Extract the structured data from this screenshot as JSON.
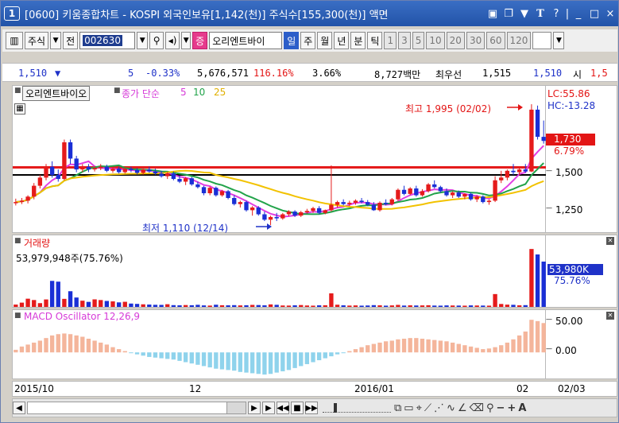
{
  "window": {
    "number": "1",
    "title": "[0600] 키움종합차트 - KOSPI 외국인보유[1,142(천)] 주식수[155,300(천)] 액면",
    "controls": [
      "□",
      "⊡",
      "▼",
      "T",
      "?",
      "_",
      "□",
      "×"
    ]
  },
  "toolbar": {
    "market_label": "주식",
    "prev_label": "전",
    "stock_code": "002630",
    "stock_name": "오리엔트바이",
    "increase_btn": "증",
    "periods": [
      "일",
      "주",
      "월",
      "년",
      "분",
      "틱"
    ],
    "active_period": "일",
    "intervals": [
      "1",
      "3",
      "5",
      "10",
      "20",
      "30",
      "60",
      "120"
    ]
  },
  "quote": {
    "price": "1,510",
    "change": "5",
    "change_pct": "-0.33%",
    "volume": "5,676,571",
    "volume_ratio": "116.16%",
    "turnover": "3.66%",
    "amount": "8,727백만",
    "best_label": "최우선",
    "best_ask": "1,515",
    "best_bid": "1,510",
    "open_label": "시",
    "open_value": "1,5"
  },
  "price_panel": {
    "stock_label": "오리엔트바이오",
    "ma_label": "종가 단순",
    "ma_periods": [
      "5",
      "10",
      "25"
    ],
    "ma_colors": [
      "#e23ee3",
      "#22a34a",
      "#f2c200"
    ],
    "high_annotation": "최고 1,995 (02/02)",
    "low_annotation": "최저 1,110 (12/14)",
    "lc": "LC:55.86",
    "hc": "HC:-13.28",
    "current_price": "1,730",
    "current_pct": "6.79%",
    "axis_ticks": [
      "1,500",
      "1,250"
    ]
  },
  "volume_panel": {
    "title": "거래량",
    "value_text": "53,979,948주(75.76%)",
    "axis_value": "53,980K",
    "axis_pct": "75.76%"
  },
  "macd_panel": {
    "title": "MACD Oscillator 12,26,9",
    "axis_ticks": [
      "50.00",
      "0.00"
    ]
  },
  "dates": {
    "labels": [
      "2015/10",
      "12",
      "2016/01",
      "02"
    ],
    "current": "02/03"
  },
  "chart_data": [
    {
      "type": "candlestick",
      "title": "오리엔트바이오",
      "ylabel": "",
      "ylim": [
        1070,
        2100
      ],
      "ticks": [
        1250,
        1500
      ],
      "ohlc": [
        [
          1275,
          1305,
          1255,
          1280
        ],
        [
          1280,
          1310,
          1265,
          1290
        ],
        [
          1290,
          1330,
          1270,
          1320
        ],
        [
          1320,
          1420,
          1300,
          1400
        ],
        [
          1400,
          1480,
          1380,
          1460
        ],
        [
          1460,
          1560,
          1440,
          1540
        ],
        [
          1540,
          1580,
          1460,
          1480
        ],
        [
          1480,
          1520,
          1430,
          1450
        ],
        [
          1450,
          1740,
          1440,
          1720
        ],
        [
          1720,
          1740,
          1560,
          1600
        ],
        [
          1600,
          1620,
          1500,
          1520
        ],
        [
          1520,
          1560,
          1500,
          1540
        ],
        [
          1540,
          1560,
          1500,
          1520
        ],
        [
          1520,
          1545,
          1505,
          1530
        ],
        [
          1530,
          1560,
          1515,
          1540
        ],
        [
          1540,
          1555,
          1500,
          1510
        ],
        [
          1510,
          1540,
          1495,
          1525
        ],
        [
          1525,
          1540,
          1490,
          1500
        ],
        [
          1500,
          1535,
          1490,
          1525
        ],
        [
          1525,
          1540,
          1500,
          1515
        ],
        [
          1515,
          1530,
          1485,
          1495
        ],
        [
          1495,
          1525,
          1480,
          1520
        ],
        [
          1520,
          1540,
          1495,
          1505
        ],
        [
          1505,
          1525,
          1480,
          1490
        ],
        [
          1490,
          1510,
          1460,
          1470
        ],
        [
          1470,
          1500,
          1450,
          1490
        ],
        [
          1490,
          1505,
          1440,
          1450
        ],
        [
          1450,
          1475,
          1420,
          1430
        ],
        [
          1430,
          1465,
          1405,
          1455
        ],
        [
          1455,
          1465,
          1400,
          1410
        ],
        [
          1410,
          1430,
          1380,
          1390
        ],
        [
          1390,
          1400,
          1330,
          1345
        ],
        [
          1345,
          1395,
          1330,
          1385
        ],
        [
          1385,
          1395,
          1320,
          1330
        ],
        [
          1330,
          1370,
          1320,
          1360
        ],
        [
          1360,
          1370,
          1300,
          1310
        ],
        [
          1310,
          1330,
          1255,
          1265
        ],
        [
          1265,
          1290,
          1240,
          1280
        ],
        [
          1280,
          1290,
          1210,
          1220
        ],
        [
          1220,
          1250,
          1180,
          1240
        ],
        [
          1240,
          1250,
          1180,
          1190
        ],
        [
          1190,
          1210,
          1140,
          1150
        ],
        [
          1150,
          1180,
          1110,
          1170
        ],
        [
          1170,
          1200,
          1140,
          1160
        ],
        [
          1160,
          1200,
          1150,
          1190
        ],
        [
          1190,
          1220,
          1175,
          1210
        ],
        [
          1210,
          1220,
          1170,
          1180
        ],
        [
          1180,
          1215,
          1170,
          1205
        ],
        [
          1205,
          1230,
          1195,
          1215
        ],
        [
          1215,
          1245,
          1200,
          1235
        ],
        [
          1235,
          1250,
          1190,
          1200
        ],
        [
          1200,
          1225,
          1190,
          1220
        ],
        [
          1220,
          1550,
          1210,
          1260
        ],
        [
          1260,
          1290,
          1240,
          1280
        ],
        [
          1280,
          1300,
          1255,
          1265
        ],
        [
          1265,
          1290,
          1250,
          1275
        ],
        [
          1275,
          1300,
          1260,
          1290
        ],
        [
          1290,
          1310,
          1270,
          1280
        ],
        [
          1280,
          1295,
          1250,
          1260
        ],
        [
          1260,
          1280,
          1215,
          1220
        ],
        [
          1220,
          1285,
          1210,
          1275
        ],
        [
          1275,
          1300,
          1255,
          1265
        ],
        [
          1265,
          1310,
          1255,
          1300
        ],
        [
          1300,
          1380,
          1290,
          1370
        ],
        [
          1370,
          1400,
          1330,
          1340
        ],
        [
          1340,
          1390,
          1330,
          1380
        ],
        [
          1380,
          1400,
          1320,
          1330
        ],
        [
          1330,
          1375,
          1320,
          1360
        ],
        [
          1360,
          1420,
          1350,
          1410
        ],
        [
          1410,
          1440,
          1380,
          1390
        ],
        [
          1390,
          1400,
          1350,
          1360
        ],
        [
          1360,
          1380,
          1320,
          1330
        ],
        [
          1330,
          1360,
          1310,
          1350
        ],
        [
          1350,
          1365,
          1310,
          1320
        ],
        [
          1320,
          1345,
          1300,
          1340
        ],
        [
          1340,
          1350,
          1290,
          1300
        ],
        [
          1300,
          1330,
          1280,
          1320
        ],
        [
          1320,
          1330,
          1270,
          1280
        ],
        [
          1280,
          1300,
          1260,
          1290
        ],
        [
          1290,
          1470,
          1280,
          1440
        ],
        [
          1440,
          1510,
          1420,
          1460
        ],
        [
          1460,
          1520,
          1440,
          1510
        ],
        [
          1510,
          1560,
          1480,
          1500
        ],
        [
          1500,
          1540,
          1480,
          1520
        ],
        [
          1520,
          1560,
          1495,
          1505
        ],
        [
          1505,
          2000,
          1500,
          1960
        ],
        [
          1960,
          1990,
          1740,
          1760
        ],
        [
          1760,
          1880,
          1710,
          1730
        ]
      ],
      "ma_series": [
        {
          "name": "5",
          "color": "#e23ee3"
        },
        {
          "name": "10",
          "color": "#22a34a"
        },
        {
          "name": "25",
          "color": "#f2c200"
        }
      ],
      "hlines": [
        {
          "value": 1535,
          "color": "#e51b1b"
        },
        {
          "value": 1480,
          "color": "#000000"
        }
      ],
      "annotations": [
        {
          "text": "최고 1,995 (02/02)",
          "value": 1995
        },
        {
          "text": "최저 1,110 (12/14)",
          "value": 1110
        }
      ]
    },
    {
      "type": "bar",
      "title": "거래량",
      "ylabel": "",
      "values": [
        2.8,
        5.1,
        9.8,
        8.2,
        4.5,
        8.9,
        31.0,
        30.1,
        9.6,
        18.7,
        11.2,
        7.4,
        6.0,
        9.0,
        8.2,
        7.1,
        6.6,
        5.4,
        6.1,
        4.0,
        3.6,
        3.1,
        2.8,
        2.5,
        2.4,
        3.2,
        2.1,
        1.9,
        2.2,
        2.0,
        2.5,
        1.8,
        1.6,
        2.6,
        2.0,
        1.9,
        2.1,
        1.8,
        2.0,
        2.4,
        2.2,
        1.9,
        3.0,
        2.5,
        1.7,
        1.6,
        1.9,
        2.2,
        1.7,
        1.5,
        1.9,
        2.0,
        16.2,
        2.6,
        1.9,
        1.6,
        1.8,
        1.5,
        1.7,
        2.1,
        1.9,
        1.5,
        1.8,
        2.4,
        1.6,
        1.9,
        1.7,
        1.8,
        2.0,
        1.6,
        1.5,
        1.8,
        1.7,
        1.6,
        1.5,
        1.8,
        1.7,
        1.6,
        1.5,
        15.3,
        3.5,
        2.7,
        2.5,
        1.9,
        2.1,
        69.0,
        62.5,
        54.0
      ],
      "ylim": [
        0,
        72
      ]
    },
    {
      "type": "bar",
      "title": "MACD Oscillator 12,26,9",
      "ylabel": "",
      "values": [
        4,
        9,
        12,
        15,
        18,
        22,
        26,
        28,
        29,
        28,
        26,
        24,
        21,
        18,
        15,
        12,
        8,
        5,
        2,
        -1,
        -3,
        -5,
        -7,
        -8,
        -9,
        -10,
        -11,
        -13,
        -15,
        -17,
        -19,
        -21,
        -23,
        -25,
        -26,
        -27,
        -28,
        -30,
        -31,
        -32,
        -33,
        -34,
        -33,
        -31,
        -29,
        -27,
        -24,
        -21,
        -18,
        -15,
        -12,
        -9,
        -6,
        -3,
        -1,
        2,
        5,
        8,
        11,
        13,
        15,
        17,
        18,
        20,
        21,
        22,
        22,
        21,
        20,
        19,
        18,
        17,
        15,
        13,
        11,
        9,
        7,
        5,
        6,
        8,
        11,
        15,
        20,
        26,
        32,
        50,
        48,
        45
      ],
      "ylim": [
        -40,
        60
      ],
      "ticks": [
        50,
        0
      ]
    }
  ]
}
